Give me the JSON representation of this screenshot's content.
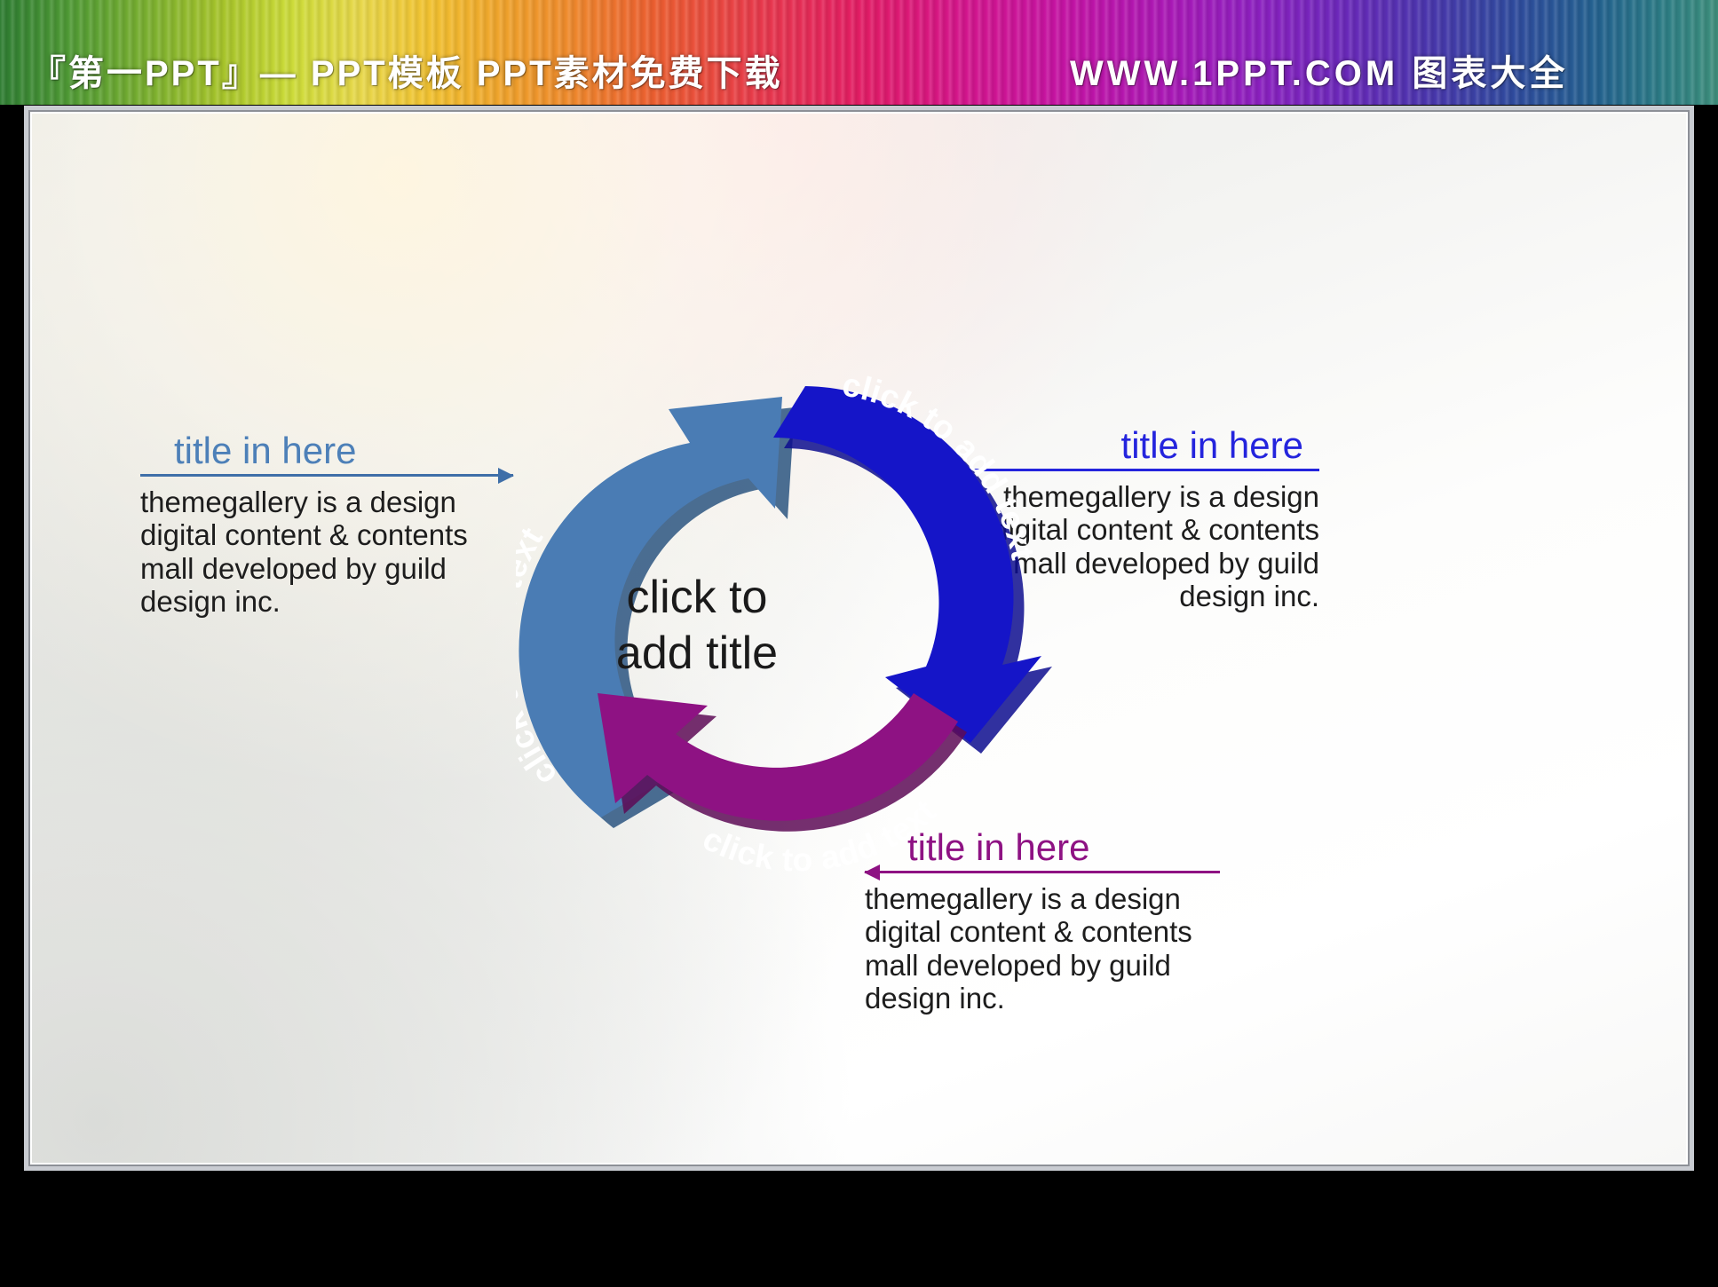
{
  "banner": {
    "left_text": "『第一PPT』— PPT模板 PPT素材免费下载",
    "right_text": "WWW.1PPT.COM 图表大全"
  },
  "slide": {
    "center_title": "click to\nadd title",
    "arcs": [
      {
        "id": "arc-blue-light",
        "label": "click to add text",
        "color": "#4a7cb4",
        "shadow": "#2c5580"
      },
      {
        "id": "arc-blue-dark",
        "label": "click to add text",
        "color": "#1515c8",
        "shadow": "#0d0d8e"
      },
      {
        "id": "arc-purple",
        "label": "click to add text",
        "color": "#8e1283",
        "shadow": "#5d0b56"
      }
    ],
    "blocks": [
      {
        "id": "left",
        "title": "title in here",
        "color": "#4d80b8",
        "body": "themegallery is a design\ndigital content & contents\nmall developed by guild\ndesign inc."
      },
      {
        "id": "right",
        "title": "title in here",
        "color": "#2424dd",
        "body": "themegallery is a design\ndigital content & contents\nmall developed by guild\ndesign inc."
      },
      {
        "id": "bottom",
        "title": "title in here",
        "color": "#8e1283",
        "body": "themegallery is a design\ndigital content & contents\nmall developed by guild\ndesign inc."
      }
    ]
  }
}
